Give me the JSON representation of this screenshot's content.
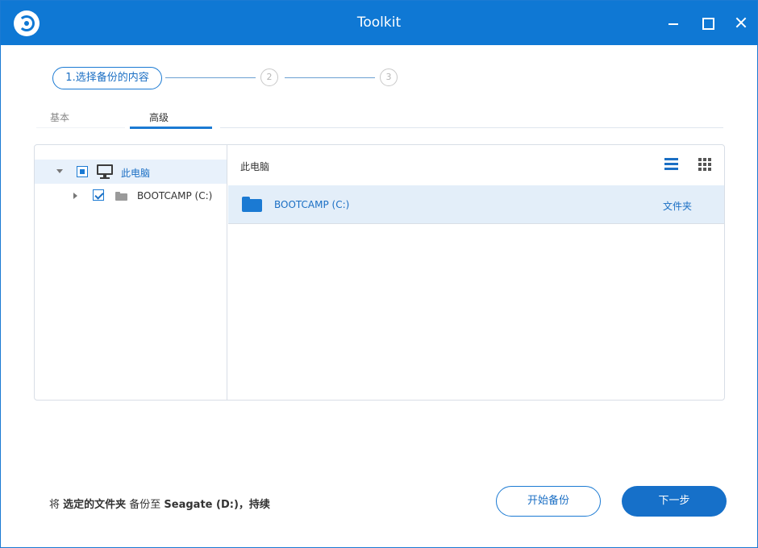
{
  "window": {
    "title": "Toolkit",
    "accent_color": "#0f78d4"
  },
  "steps": [
    {
      "label": "1.选择备份的内容",
      "active": true
    },
    {
      "label": "2",
      "active": false
    },
    {
      "label": "3",
      "active": false
    }
  ],
  "tabs": [
    {
      "label": "基本",
      "active": false
    },
    {
      "label": "高级",
      "active": true
    }
  ],
  "tree": {
    "items": [
      {
        "label": "此电脑",
        "icon": "monitor-icon",
        "checkbox": "partial",
        "expanded": true,
        "selected": true
      },
      {
        "label": "BOOTCAMP (C:)",
        "icon": "folder-icon",
        "checkbox": "checked",
        "expanded": false,
        "selected": false
      }
    ]
  },
  "content": {
    "header": "此电脑",
    "rows": [
      {
        "name": "BOOTCAMP (C:)",
        "type": "文件夹",
        "icon": "folder-icon"
      }
    ]
  },
  "footer": {
    "part1": "将 ",
    "part2": "选定的文件夹",
    "part3": " 备份至 ",
    "part4": "Seagate (D:)",
    "part5": "，持续",
    "start_button": "开始备份",
    "next_button": "下一步"
  }
}
